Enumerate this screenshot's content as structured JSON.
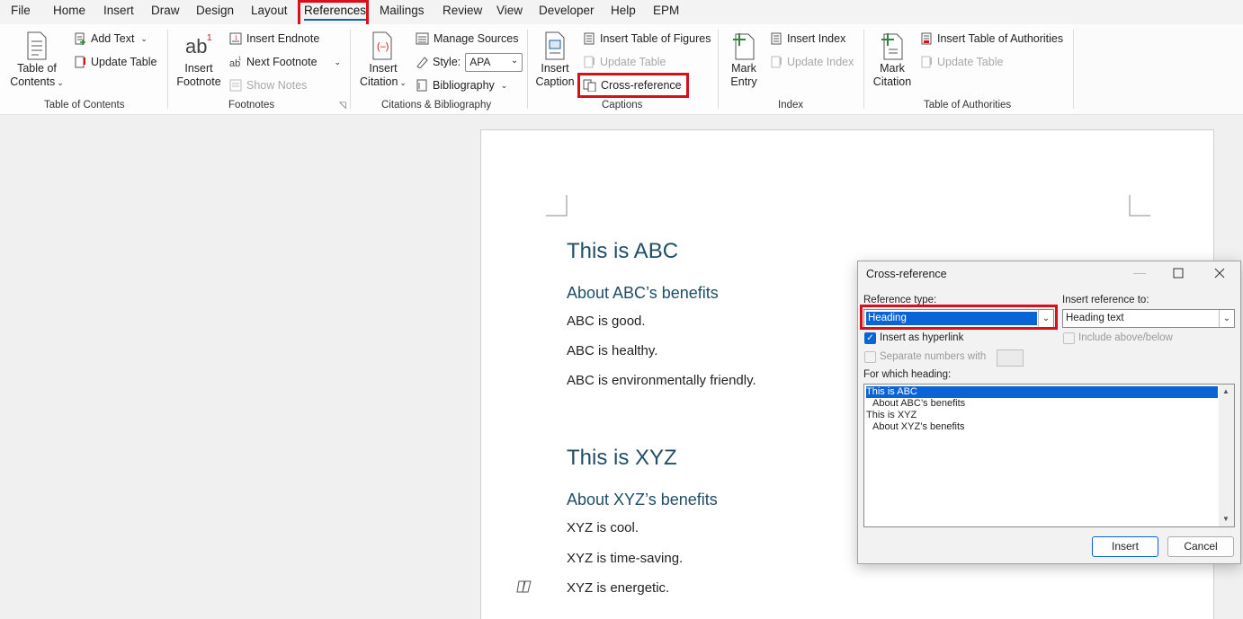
{
  "tabs": [
    "File",
    "Home",
    "Insert",
    "Draw",
    "Design",
    "Layout",
    "References",
    "Mailings",
    "Review",
    "View",
    "Developer",
    "Help",
    "EPM"
  ],
  "active_tab": "References",
  "ribbon": {
    "toc": {
      "big_label_1": "Table of",
      "big_label_2": "Contents",
      "add_text": "Add Text",
      "update_table": "Update Table",
      "group": "Table of Contents"
    },
    "footnotes": {
      "big_label_1": "Insert",
      "big_label_2": "Footnote",
      "insert_endnote": "Insert Endnote",
      "next_footnote": "Next Footnote",
      "show_notes": "Show Notes",
      "group": "Footnotes"
    },
    "citations": {
      "big_label_1": "Insert",
      "big_label_2": "Citation",
      "manage_sources": "Manage Sources",
      "style_label": "Style:",
      "style_value": "APA",
      "bibliography": "Bibliography",
      "group": "Citations & Bibliography"
    },
    "captions": {
      "big_label_1": "Insert",
      "big_label_2": "Caption",
      "insert_tof": "Insert Table of Figures",
      "update_table": "Update Table",
      "cross_reference": "Cross-reference",
      "group": "Captions"
    },
    "index": {
      "big_label_1": "Mark",
      "big_label_2": "Entry",
      "insert_index": "Insert Index",
      "update_index": "Update Index",
      "group": "Index"
    },
    "authorities": {
      "big_label_1": "Mark",
      "big_label_2": "Citation",
      "insert_toa": "Insert Table of Authorities",
      "update_table": "Update Table",
      "group": "Table of Authorities"
    }
  },
  "document": {
    "h1_a": "This is ABC",
    "h2_a": "About ABC’s benefits",
    "p_a1": "ABC is good.",
    "p_a2": "ABC is healthy.",
    "p_a3": "ABC is environmentally friendly.",
    "h1_b": "This is XYZ",
    "h2_b": "About XYZ’s benefits",
    "p_b1": "XYZ is cool.",
    "p_b2": "XYZ is time-saving.",
    "p_b3": "XYZ is energetic."
  },
  "dialog": {
    "title": "Cross-reference",
    "ref_type_label": "Reference type:",
    "ref_type_value": "Heading",
    "insert_ref_label": "Insert reference to:",
    "insert_ref_value": "Heading text",
    "hyperlink_label": "Insert as hyperlink",
    "hyperlink_checked": true,
    "above_below_label": "Include above/below",
    "separate_label": "Separate numbers with",
    "which_heading_label": "For which heading:",
    "headings": [
      "This is ABC",
      "About ABC’s benefits",
      "This is XYZ",
      "About XYZ’s benefits"
    ],
    "selected_heading": "This is ABC",
    "insert_button": "Insert",
    "cancel_button": "Cancel"
  },
  "colors": {
    "highlight_box": "#d8101a",
    "heading_text": "#1f4e68",
    "selection": "#0a64d6"
  }
}
